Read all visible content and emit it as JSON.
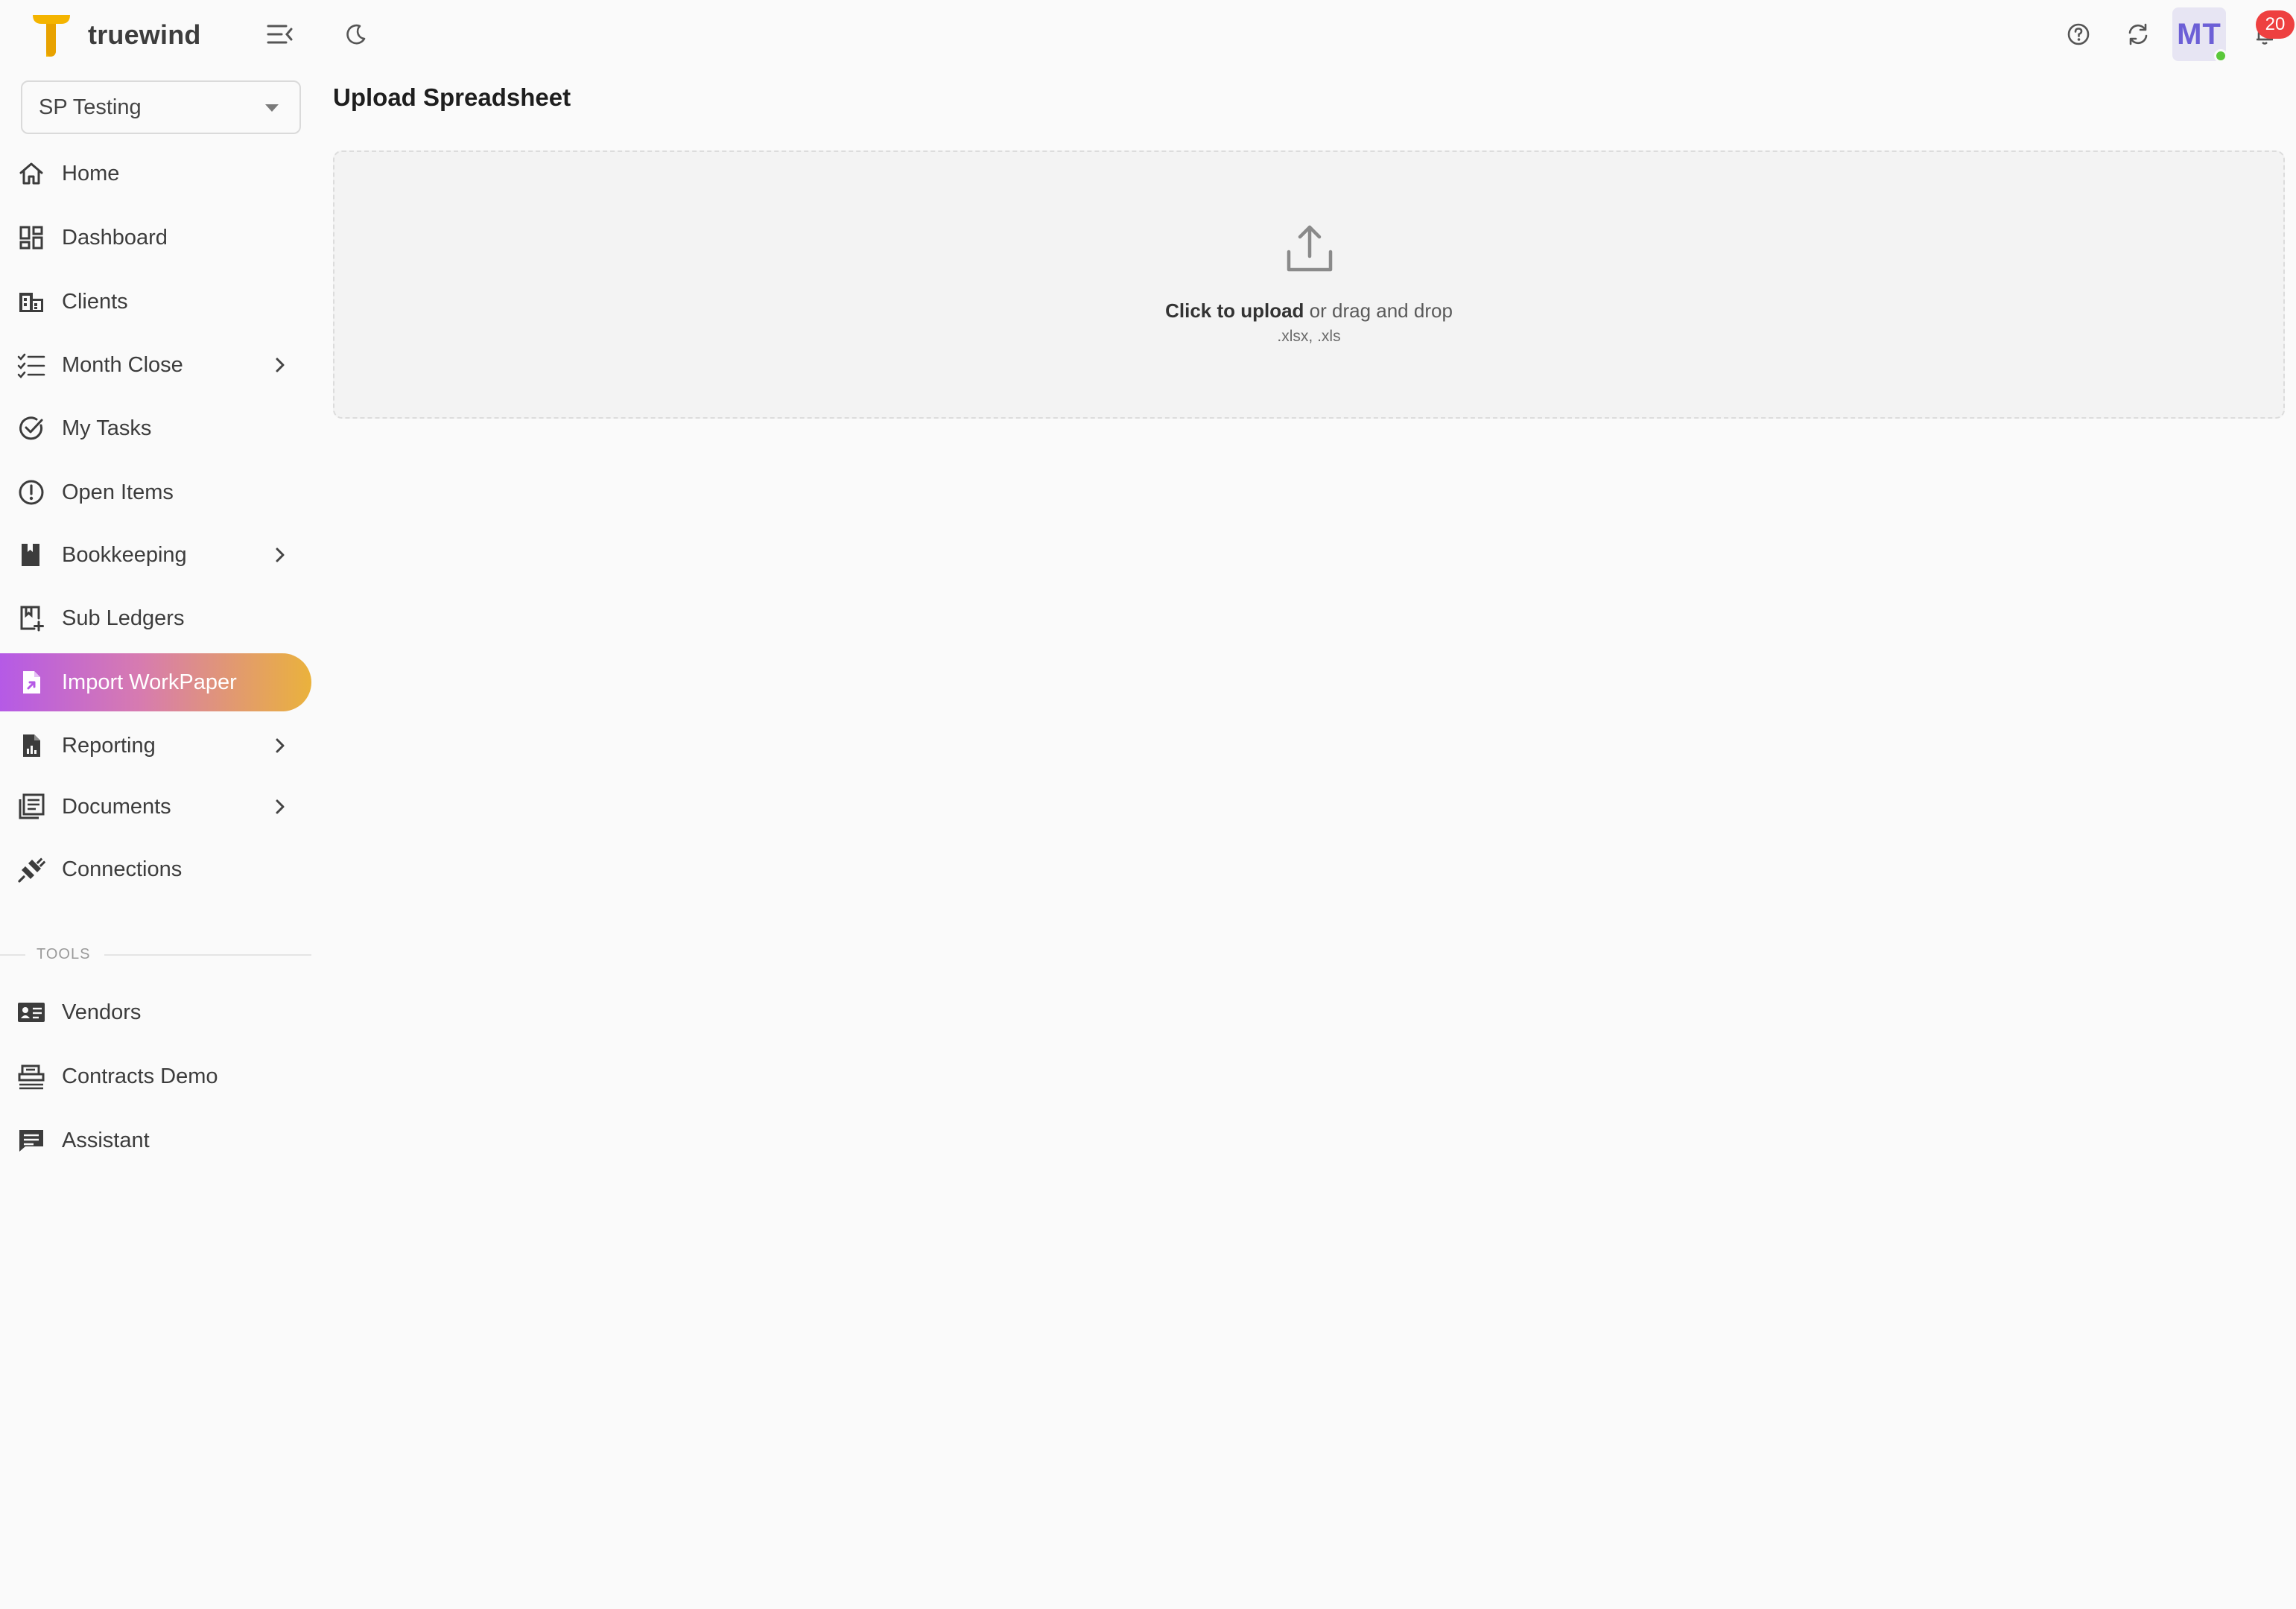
{
  "brand": {
    "name": "truewind",
    "logo_icon": "t-logo-icon",
    "logo_color": "#f4b400"
  },
  "org_select": {
    "value": "SP Testing"
  },
  "nav": {
    "items": [
      {
        "label": "Home",
        "icon": "home-icon",
        "expandable": false
      },
      {
        "label": "Dashboard",
        "icon": "dashboard-icon",
        "expandable": false
      },
      {
        "label": "Clients",
        "icon": "building-icon",
        "expandable": false
      },
      {
        "label": "Month Close",
        "icon": "checklist-icon",
        "expandable": true
      },
      {
        "label": "My Tasks",
        "icon": "check-circle-icon",
        "expandable": false
      },
      {
        "label": "Open Items",
        "icon": "alert-circle-icon",
        "expandable": false
      },
      {
        "label": "Bookkeeping",
        "icon": "book-icon",
        "expandable": true
      },
      {
        "label": "Sub Ledgers",
        "icon": "ledger-add-icon",
        "expandable": false
      },
      {
        "label": "Import WorkPaper",
        "icon": "file-import-icon",
        "expandable": false,
        "active": true
      },
      {
        "label": "Reporting",
        "icon": "report-icon",
        "expandable": true
      },
      {
        "label": "Documents",
        "icon": "documents-icon",
        "expandable": true
      },
      {
        "label": "Connections",
        "icon": "plug-icon",
        "expandable": false
      }
    ],
    "tools_label": "TOOLS",
    "tools": [
      {
        "label": "Vendors",
        "icon": "contact-card-icon"
      },
      {
        "label": "Contracts Demo",
        "icon": "contract-icon"
      },
      {
        "label": "Assistant",
        "icon": "chat-icon"
      }
    ]
  },
  "topbar": {
    "avatar_initials": "MT",
    "notification_count": "20",
    "icons": [
      "help-icon",
      "refresh-icon",
      "bell-icon"
    ]
  },
  "main": {
    "title": "Upload Spreadsheet",
    "dropzone": {
      "click_text": "Click to upload",
      "drag_text": " or drag and drop",
      "hint": ".xlsx, .xls"
    }
  },
  "colors": {
    "active_gradient_start": "#b55ae6",
    "active_gradient_end": "#eab23c",
    "badge": "#ee4040",
    "avatar_text": "#6c5fd6",
    "online": "#5ac83a"
  }
}
